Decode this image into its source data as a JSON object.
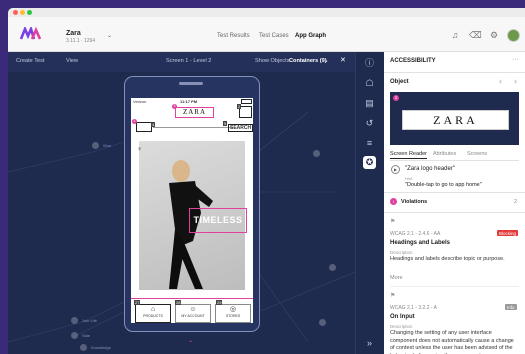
{
  "app": {
    "name": "Zara",
    "version": "3.11.1 · 1294"
  },
  "nav": {
    "test_results": "Test Results",
    "test_cases": "Test Cases",
    "app_graph": "App Graph"
  },
  "toolbar": {
    "create_test": "Create Test",
    "view": "View",
    "screen_label": "Screen 1 - Level 2",
    "show_objects": "Show Objects",
    "containers": "Containers (9)"
  },
  "phone": {
    "carrier": "Verizon",
    "time": "11:17 PM",
    "logo": "ZARA",
    "search": "SEARCH",
    "hero_text": "TIMELESS",
    "tabs": [
      "PRODUCTS",
      "MY ACCOUNT",
      "STORES"
    ],
    "tags": [
      "1",
      "2",
      "3",
      "4",
      "5",
      "27",
      "28",
      "29"
    ]
  },
  "graph": {
    "labels": [
      "Woo",
      "Join Life",
      "Sale",
      "Knowledge"
    ]
  },
  "panel": {
    "title": "ACCESSIBILITY",
    "more": "···",
    "object_label": "Object",
    "preview_logo": "ZARA",
    "preview_tag": "3",
    "tabs": [
      "Screen Reader",
      "Attributes",
      "Screens"
    ],
    "sr_label": "\"Zara logo header\"",
    "hint_label": "Hint",
    "sr_hint": "\"Double-tap to go to app home\"",
    "violations_label": "Violations",
    "violations_count": "2",
    "v1": {
      "code": "WCAG 2.1 - 2.4.6 - AA",
      "badge": "Blocking",
      "title": "Headings and Labels",
      "desc_label": "Description",
      "desc": "Headings and labels describe topic or purpose.",
      "more": "More"
    },
    "v2": {
      "code": "WCAG 2.1 - 3.2.2 - A",
      "badge": "Info",
      "title": "On Input",
      "desc_label": "Description",
      "desc": "Changing the setting of any user interface component does not automatically cause a change of context unless the user has been advised of the behavior before using the component."
    }
  },
  "colors": {
    "accent": "#e040a0",
    "canvas": "#1f2b4e",
    "brand": "#7b3fe4",
    "blocking": "#e03a3a"
  }
}
